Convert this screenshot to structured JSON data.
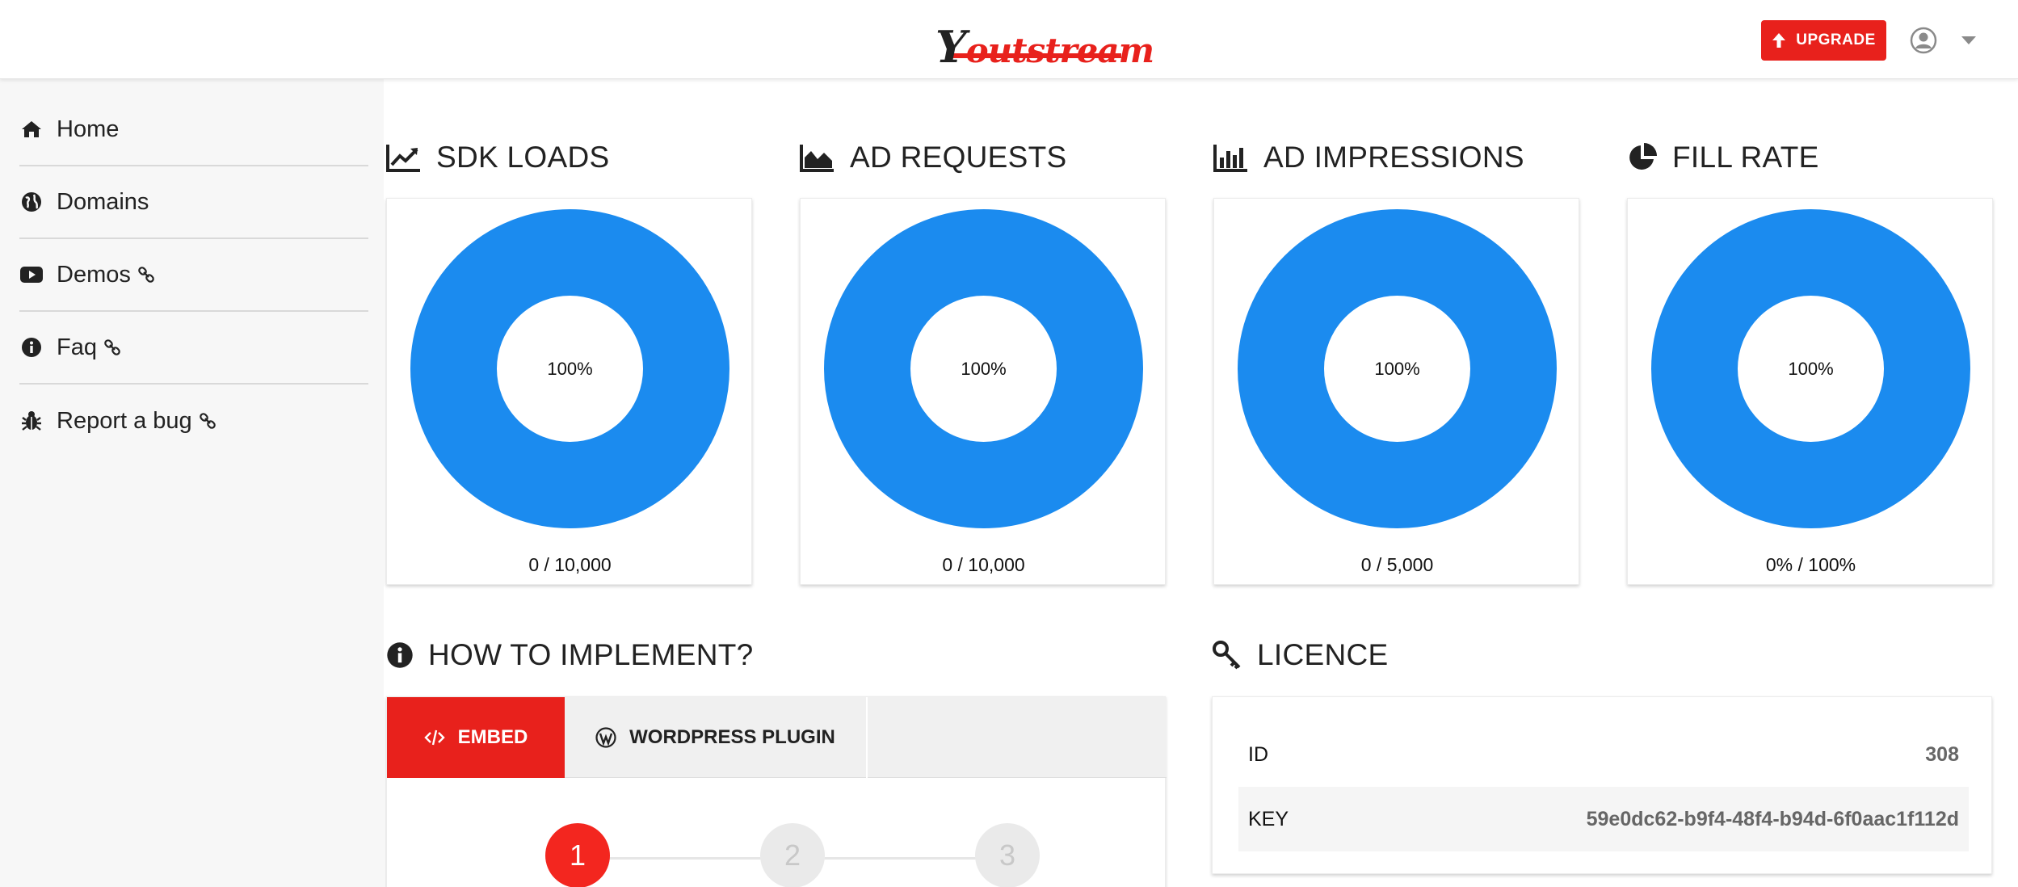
{
  "brand": {
    "logo_first_letter": "Y",
    "logo_rest": "outstream",
    "accent_color": "#e8211c"
  },
  "header": {
    "upgrade_label": "UPGRADE",
    "upgrade_icon": "arrow-up-icon",
    "user_icon": "user-circle-icon",
    "user_menu_icon": "caret-down-icon"
  },
  "sidebar": {
    "items": [
      {
        "label": "Home",
        "icon": "home-icon",
        "external": false
      },
      {
        "label": "Domains",
        "icon": "globe-icon",
        "external": false
      },
      {
        "label": "Demos",
        "icon": "youtube-play-icon",
        "external": true
      },
      {
        "label": "Faq",
        "icon": "info-circle-icon",
        "external": true
      },
      {
        "label": "Report a bug",
        "icon": "bug-icon",
        "external": true
      }
    ]
  },
  "stats": [
    {
      "title": "SDK LOADS",
      "icon": "line-chart-icon",
      "percent_label": "100%",
      "percent": 100,
      "footer": "0 / 10,000"
    },
    {
      "title": "AD REQUESTS",
      "icon": "area-chart-icon",
      "percent_label": "100%",
      "percent": 100,
      "footer": "0 / 10,000"
    },
    {
      "title": "AD IMPRESSIONS",
      "icon": "bar-chart-icon",
      "percent_label": "100%",
      "percent": 100,
      "footer": "0 / 5,000"
    },
    {
      "title": "FILL RATE",
      "icon": "pie-chart-icon",
      "percent_label": "100%",
      "percent": 100,
      "footer": "0% / 100%"
    }
  ],
  "donut_color": "#1b8bef",
  "implement": {
    "title": "HOW TO IMPLEMENT?",
    "tabs": [
      {
        "label": "EMBED",
        "icon": "code-icon",
        "active": true
      },
      {
        "label": "WORDPRESS PLUGIN",
        "icon": "wordpress-icon",
        "active": false
      }
    ],
    "steps": [
      "1",
      "2",
      "3"
    ],
    "active_step": 1
  },
  "licence": {
    "title": "LICENCE",
    "rows": [
      {
        "key": "ID",
        "value": "308"
      },
      {
        "key": "KEY",
        "value": "59e0dc62-b9f4-48f4-b94d-6f0aac1f112d"
      }
    ]
  }
}
